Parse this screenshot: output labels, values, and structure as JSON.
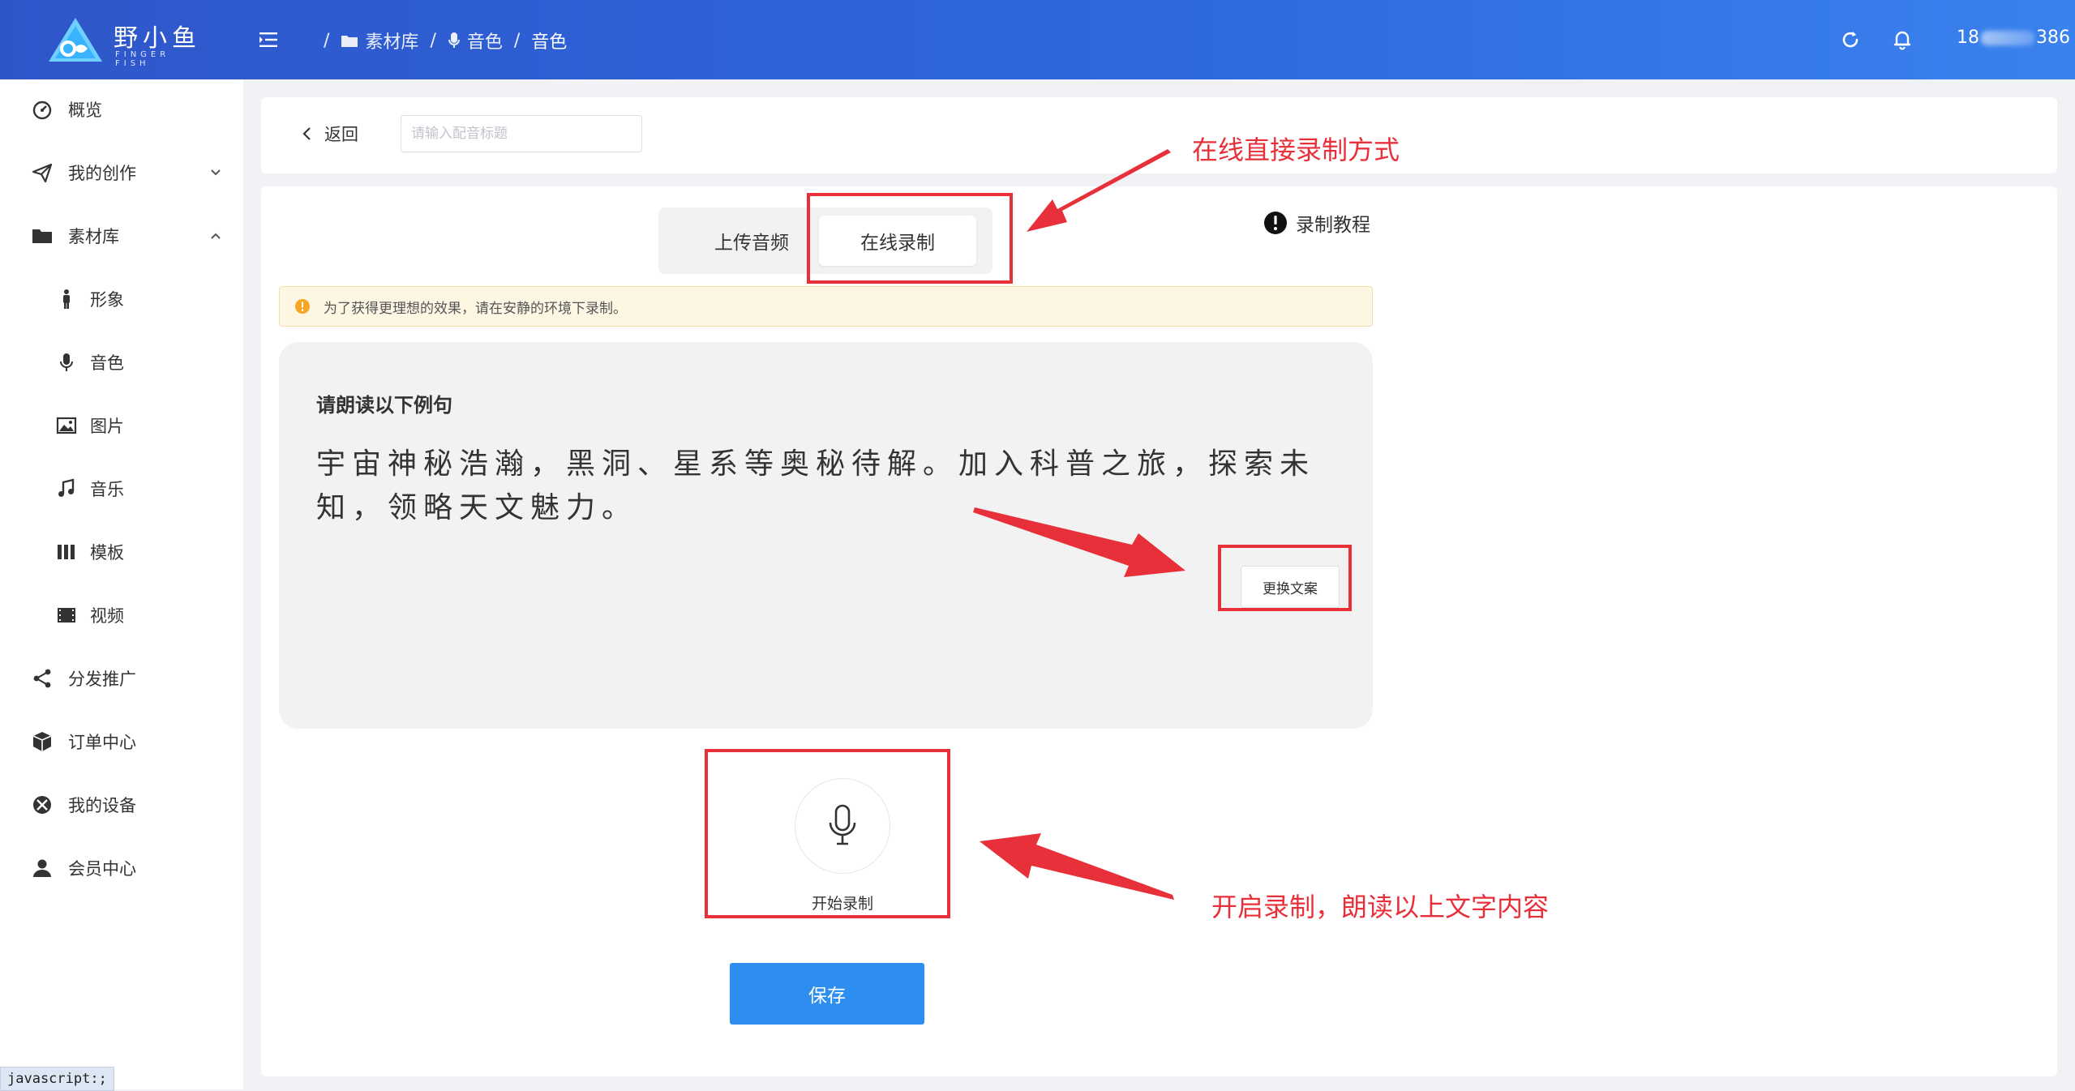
{
  "brand": {
    "name": "野小鱼",
    "sub": "FINGER FISH"
  },
  "breadcrumb": [
    {
      "label": "素材库",
      "icon": "folder-icon"
    },
    {
      "label": "音色",
      "icon": "mic-icon"
    },
    {
      "label": "音色",
      "icon": ""
    }
  ],
  "header": {
    "user_prefix": "18",
    "user_suffix": "386"
  },
  "sidebar": {
    "items": [
      {
        "label": "概览",
        "icon": "dashboard-icon"
      },
      {
        "label": "我的创作",
        "icon": "send-icon",
        "expanded": false
      },
      {
        "label": "素材库",
        "icon": "folder-icon",
        "expanded": true
      },
      {
        "label": "形象",
        "icon": "person-icon"
      },
      {
        "label": "音色",
        "icon": "mic-icon"
      },
      {
        "label": "图片",
        "icon": "image-icon"
      },
      {
        "label": "音乐",
        "icon": "music-icon"
      },
      {
        "label": "模板",
        "icon": "template-icon"
      },
      {
        "label": "视频",
        "icon": "video-icon"
      },
      {
        "label": "分发推广",
        "icon": "share-icon"
      },
      {
        "label": "订单中心",
        "icon": "box-icon"
      },
      {
        "label": "我的设备",
        "icon": "device-icon"
      },
      {
        "label": "会员中心",
        "icon": "user-icon"
      }
    ]
  },
  "status_bar": "javascript:;",
  "topbar": {
    "back_label": "返回",
    "title_placeholder": "请输入配音标题",
    "title_value": ""
  },
  "tabs": {
    "upload": "上传音频",
    "online": "在线录制",
    "active": "online"
  },
  "tutorial_label": "录制教程",
  "notice": "为了获得更理想的效果，请在安静的环境下录制。",
  "reading": {
    "title": "请朗读以下例句",
    "text": "宇宙神秘浩瀚，黑洞、星系等奥秘待解。加入科普之旅，探索未知，领略天文魅力。",
    "change_label": "更换文案"
  },
  "record_label": "开始录制",
  "save_label": "保存",
  "annotations": {
    "online_mode": "在线直接录制方式",
    "start_record": "开启录制，朗读以上文字内容"
  },
  "colors": {
    "header": "#2d68de",
    "primary": "#2e8ef0",
    "annotation": "#e8303a",
    "notice_bg": "#fdf6e3"
  }
}
